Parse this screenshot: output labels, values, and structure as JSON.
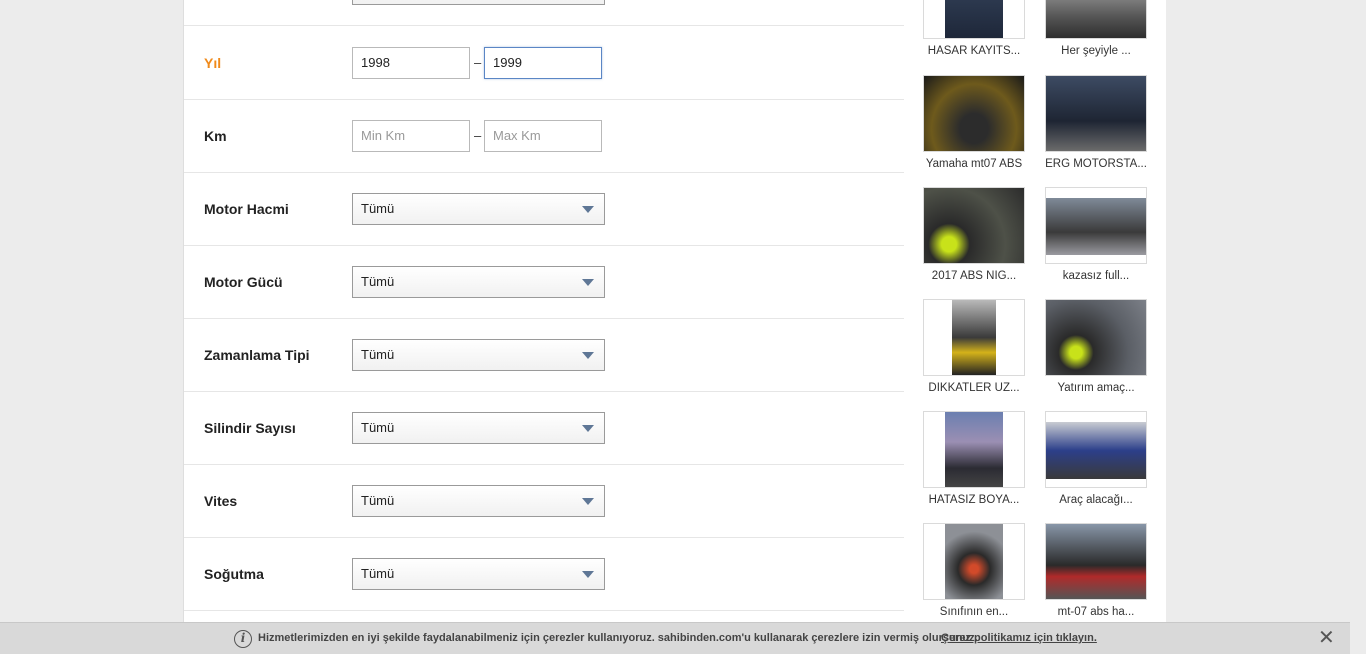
{
  "filters": {
    "yil": {
      "label": "Yıl",
      "min_value": "1998",
      "max_value": "1999",
      "separator": "–"
    },
    "km": {
      "label": "Km",
      "min_placeholder": "Min Km",
      "max_placeholder": "Max Km",
      "separator": "–"
    },
    "selects": [
      {
        "label": "Motor Hacmi",
        "value": "Tümü"
      },
      {
        "label": "Motor Gücü",
        "value": "Tümü"
      },
      {
        "label": "Zamanlama Tipi",
        "value": "Tümü"
      },
      {
        "label": "Silindir Sayısı",
        "value": "Tümü"
      },
      {
        "label": "Vites",
        "value": "Tümü"
      },
      {
        "label": "Soğutma",
        "value": "Tümü"
      }
    ]
  },
  "listings": [
    {
      "caption": "HASAR KAYITS..."
    },
    {
      "caption": "Her şeyiyle ..."
    },
    {
      "caption": "Yamaha mt07 ABS"
    },
    {
      "caption": "ERG MOTORSTA..."
    },
    {
      "caption": "2017 ABS NIG..."
    },
    {
      "caption": "kazasız full..."
    },
    {
      "caption": "DİKKATLER ÜZ..."
    },
    {
      "caption": "Yatırım amaç..."
    },
    {
      "caption": "HATASIZ BOYA..."
    },
    {
      "caption": "Araç alacağı..."
    },
    {
      "caption": "Sınıfının en..."
    },
    {
      "caption": "mt-07 abs ha..."
    }
  ],
  "cookie_bar": {
    "message": "Hizmetlerimizden en iyi şekilde faydalanabilmeniz için çerezler kullanıyoruz. sahibinden.com'u kullanarak çerezlere izin vermiş olursunuz.",
    "link": "Çerez politikamız için tıklayın.",
    "close": "✕",
    "info_icon": "i"
  }
}
